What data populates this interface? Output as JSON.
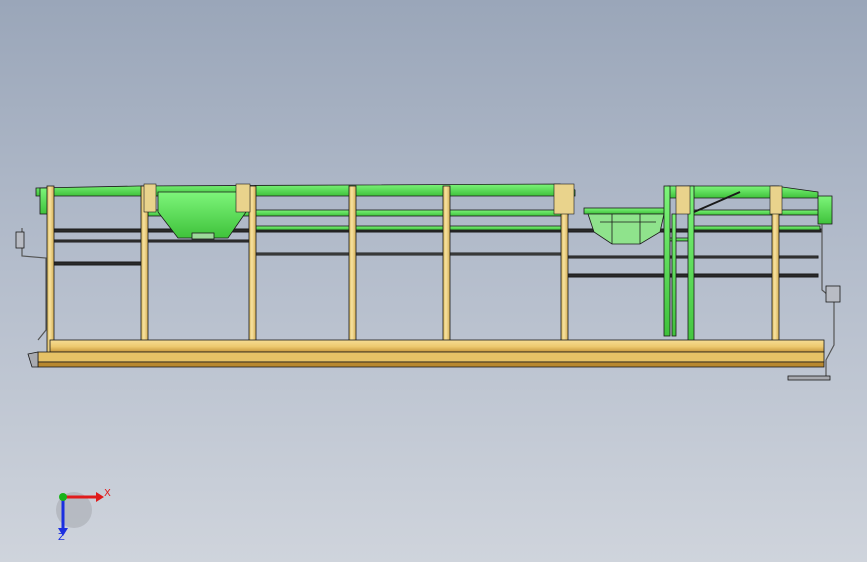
{
  "viewport": {
    "background_top": "#9aa6b9",
    "background_bottom": "#cfd4dc"
  },
  "model": {
    "name": "frame-assembly",
    "colors": {
      "post": "#f4d98a",
      "post_shadow": "#d9b65a",
      "deck": "#f0cf78",
      "deck_dark": "#c89a3e",
      "bracket": "#5ee35a",
      "bracket_dark": "#2ea82a",
      "edge": "#1a1a1a",
      "detail": "#b9bcc4"
    }
  },
  "triad": {
    "x_label": "X",
    "z_label": "Z",
    "x_color": "#e01b1b",
    "y_color": "#19b319",
    "z_color": "#1b2fe0"
  }
}
